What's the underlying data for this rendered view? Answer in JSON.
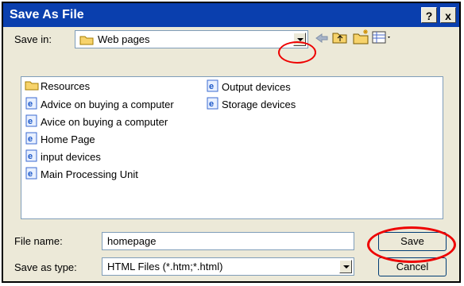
{
  "dialog": {
    "title": "Save As File",
    "help_label": "?",
    "close_label": "x"
  },
  "toolbar": {
    "save_in_label": "Save in:",
    "save_in_value": "Web pages"
  },
  "files": {
    "col1": [
      "Resources",
      "Advice on buying a computer",
      "Avice on buying a computer",
      "Home Page",
      "input devices",
      "Main Processing Unit"
    ],
    "col2": [
      "Output devices",
      "Storage devices"
    ]
  },
  "form": {
    "filename_label": "File name:",
    "filename_value": "homepage",
    "type_label": "Save as type:",
    "type_value": "HTML Files (*.htm;*.html)"
  },
  "buttons": {
    "save": "Save",
    "cancel": "Cancel"
  },
  "colors": {
    "title_bar": "#0a3fae",
    "annotation_ring": "#ee0000"
  }
}
